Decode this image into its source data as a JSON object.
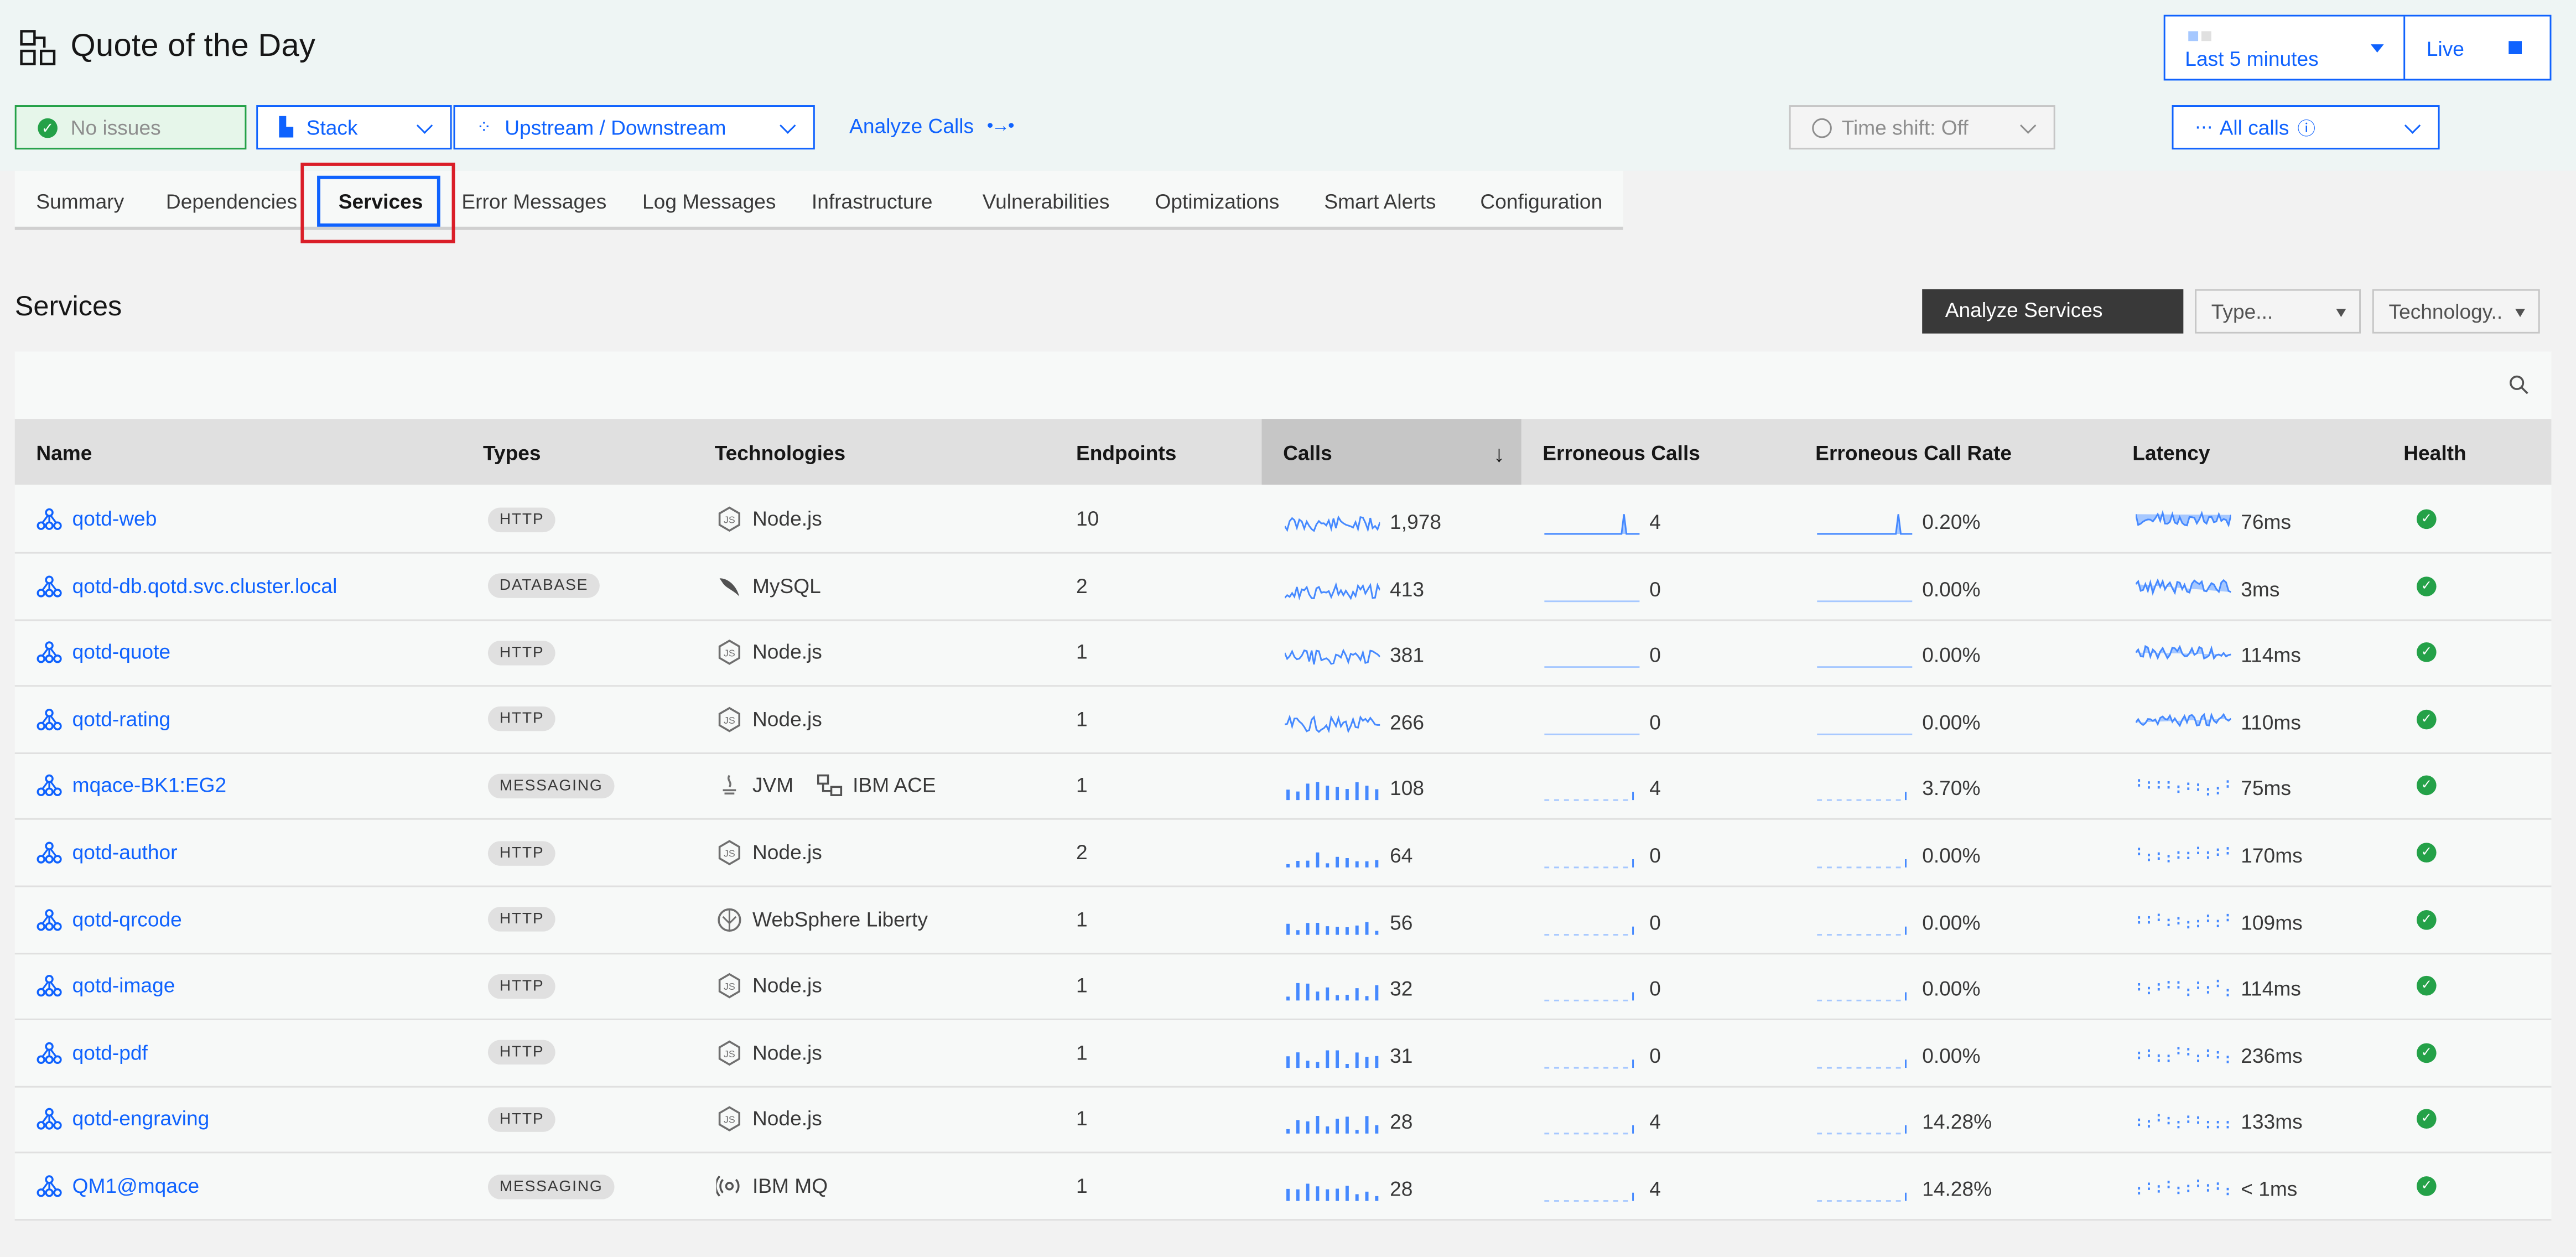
{
  "header": {
    "title": "Quote of the Day",
    "time_range": "Last 5 minutes",
    "live_label": "Live"
  },
  "toolbar": {
    "status": "No issues",
    "stack": "Stack",
    "upstream": "Upstream / Downstream",
    "analyze_calls": "Analyze Calls",
    "time_shift": "Time shift: Off",
    "all_calls": "All calls"
  },
  "tabs": [
    "Summary",
    "Dependencies",
    "Services",
    "Error Messages",
    "Log Messages",
    "Infrastructure",
    "Vulnerabilities",
    "Optimizations",
    "Smart Alerts",
    "Configuration"
  ],
  "active_tab": "Services",
  "services": {
    "title": "Services",
    "analyze_button": "Analyze Services",
    "type_filter": "Type...",
    "tech_filter": "Technology.."
  },
  "table": {
    "columns": [
      "Name",
      "Types",
      "Technologies",
      "Endpoints",
      "Calls",
      "Erroneous Calls",
      "Erroneous Call Rate",
      "Latency",
      "Health"
    ],
    "rows": [
      {
        "name": "qotd-web",
        "type": "HTTP",
        "tech": [
          "Node.js"
        ],
        "endpoints": "10",
        "calls": "1,978",
        "err_calls": "4",
        "err_rate": "0.20%",
        "latency": "76ms"
      },
      {
        "name": "qotd-db.qotd.svc.cluster.local",
        "type": "DATABASE",
        "tech": [
          "MySQL"
        ],
        "endpoints": "2",
        "calls": "413",
        "err_calls": "0",
        "err_rate": "0.00%",
        "latency": "3ms"
      },
      {
        "name": "qotd-quote",
        "type": "HTTP",
        "tech": [
          "Node.js"
        ],
        "endpoints": "1",
        "calls": "381",
        "err_calls": "0",
        "err_rate": "0.00%",
        "latency": "114ms"
      },
      {
        "name": "qotd-rating",
        "type": "HTTP",
        "tech": [
          "Node.js"
        ],
        "endpoints": "1",
        "calls": "266",
        "err_calls": "0",
        "err_rate": "0.00%",
        "latency": "110ms"
      },
      {
        "name": "mqace-BK1:EG2",
        "type": "MESSAGING",
        "tech": [
          "JVM",
          "IBM ACE"
        ],
        "endpoints": "1",
        "calls": "108",
        "err_calls": "4",
        "err_rate": "3.70%",
        "latency": "75ms"
      },
      {
        "name": "qotd-author",
        "type": "HTTP",
        "tech": [
          "Node.js"
        ],
        "endpoints": "2",
        "calls": "64",
        "err_calls": "0",
        "err_rate": "0.00%",
        "latency": "170ms"
      },
      {
        "name": "qotd-qrcode",
        "type": "HTTP",
        "tech": [
          "WebSphere Liberty"
        ],
        "endpoints": "1",
        "calls": "56",
        "err_calls": "0",
        "err_rate": "0.00%",
        "latency": "109ms"
      },
      {
        "name": "qotd-image",
        "type": "HTTP",
        "tech": [
          "Node.js"
        ],
        "endpoints": "1",
        "calls": "32",
        "err_calls": "0",
        "err_rate": "0.00%",
        "latency": "114ms"
      },
      {
        "name": "qotd-pdf",
        "type": "HTTP",
        "tech": [
          "Node.js"
        ],
        "endpoints": "1",
        "calls": "31",
        "err_calls": "0",
        "err_rate": "0.00%",
        "latency": "236ms"
      },
      {
        "name": "qotd-engraving",
        "type": "HTTP",
        "tech": [
          "Node.js"
        ],
        "endpoints": "1",
        "calls": "28",
        "err_calls": "4",
        "err_rate": "14.28%",
        "latency": "133ms"
      },
      {
        "name": "QM1@mqace",
        "type": "MESSAGING",
        "tech": [
          "IBM MQ"
        ],
        "endpoints": "1",
        "calls": "28",
        "err_calls": "4",
        "err_rate": "14.28%",
        "latency": "< 1ms"
      }
    ]
  },
  "colors": {
    "accent": "#0f62fe",
    "ok": "#24a148",
    "highlight": "#da1e28",
    "spark": "#4589ff"
  }
}
